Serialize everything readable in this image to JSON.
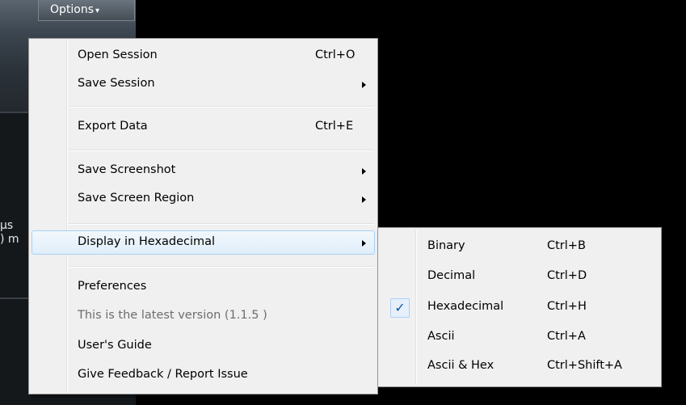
{
  "toolbar": {
    "options_label": "Options",
    "options_arrow": "▾"
  },
  "background": {
    "line1": "μs",
    "line2": ") m"
  },
  "options_menu": {
    "items": [
      {
        "label": "Open Session",
        "shortcut": "Ctrl+O"
      },
      {
        "label": "Save Session",
        "submenu": true
      },
      {
        "label": "Export Data",
        "shortcut": "Ctrl+E"
      },
      {
        "label": "Save Screenshot",
        "submenu": true
      },
      {
        "label": "Save Screen Region",
        "submenu": true
      },
      {
        "label": "Display in Hexadecimal",
        "submenu": true,
        "highlighted": true
      },
      {
        "label": "Preferences"
      },
      {
        "label": "This is the latest version (1.1.5 )",
        "disabled": true
      },
      {
        "label": "User's Guide"
      },
      {
        "label": "Give Feedback / Report Issue"
      }
    ]
  },
  "display_submenu": {
    "items": [
      {
        "label": "Binary",
        "shortcut": "Ctrl+B"
      },
      {
        "label": "Decimal",
        "shortcut": "Ctrl+D"
      },
      {
        "label": "Hexadecimal",
        "shortcut": "Ctrl+H",
        "checked": true
      },
      {
        "label": "Ascii",
        "shortcut": "Ctrl+A"
      },
      {
        "label": "Ascii & Hex",
        "shortcut": "Ctrl+Shift+A"
      }
    ],
    "check_glyph": "✓"
  },
  "colors": {
    "highlight_border": "#a8d2f5",
    "check": "#0b54a6",
    "menu_bg": "#f0f0f0"
  }
}
